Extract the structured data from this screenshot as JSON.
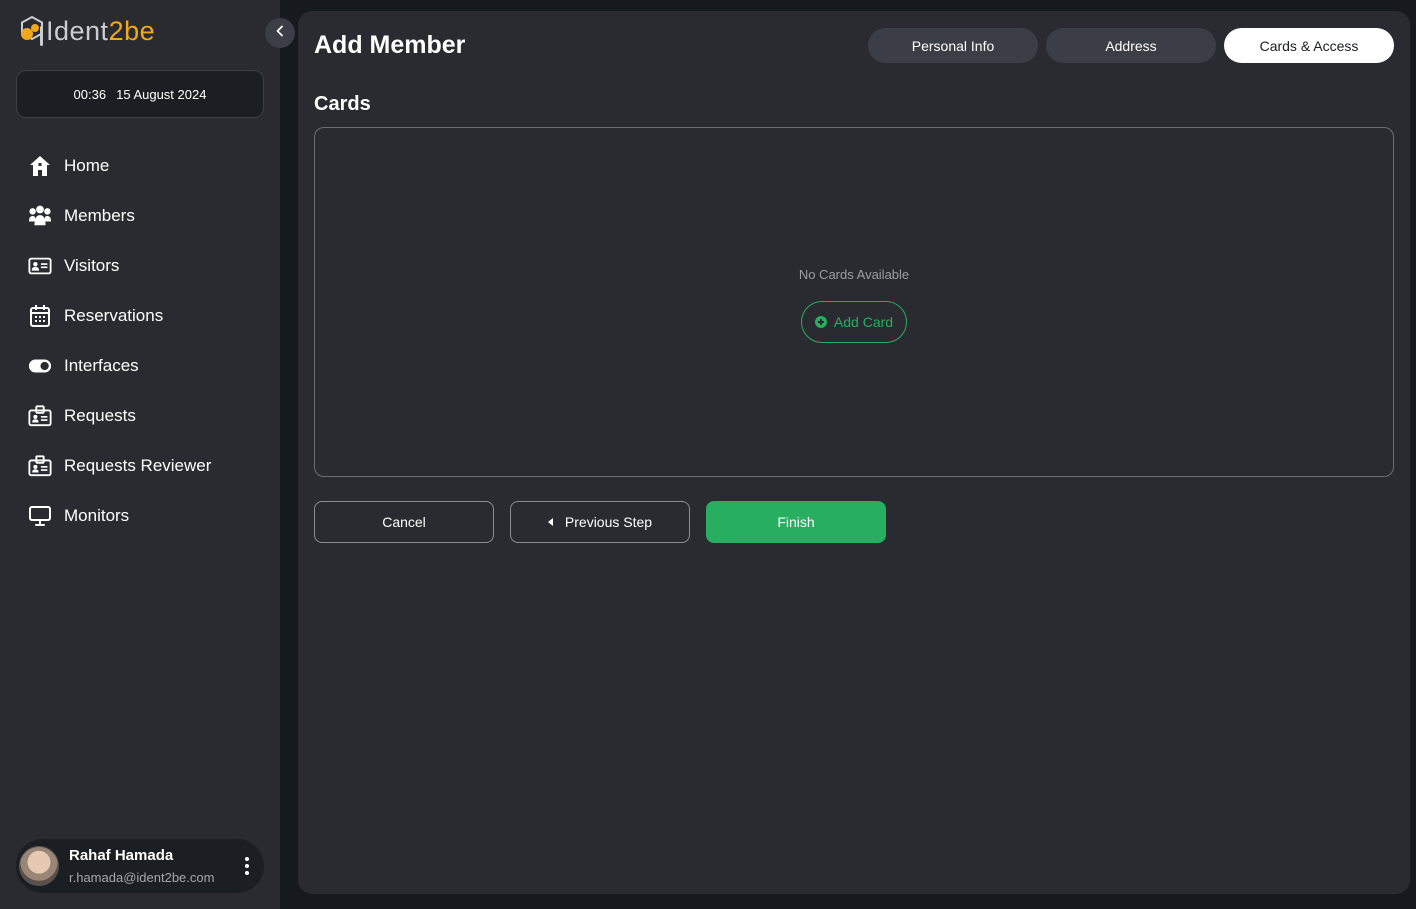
{
  "brand": {
    "name_part1": "Ident",
    "name_part2": "2be"
  },
  "clock": {
    "time": "00:36",
    "date": "15 August 2024"
  },
  "sidebar": {
    "items": [
      {
        "label": "Home",
        "icon": "home-icon"
      },
      {
        "label": "Members",
        "icon": "members-icon"
      },
      {
        "label": "Visitors",
        "icon": "visitor-card-icon"
      },
      {
        "label": "Reservations",
        "icon": "calendar-icon"
      },
      {
        "label": "Interfaces",
        "icon": "toggle-icon"
      },
      {
        "label": "Requests",
        "icon": "badge-icon"
      },
      {
        "label": "Requests Reviewer",
        "icon": "badge-icon"
      },
      {
        "label": "Monitors",
        "icon": "monitor-icon"
      }
    ]
  },
  "user": {
    "name": "Rahaf Hamada",
    "email": "r.hamada@ident2be.com"
  },
  "header": {
    "title": "Add Member",
    "tabs": [
      {
        "label": "Personal Info",
        "active": false
      },
      {
        "label": "Address",
        "active": false
      },
      {
        "label": "Cards & Access",
        "active": true
      }
    ]
  },
  "cards": {
    "title": "Cards",
    "empty_text": "No Cards Available",
    "add_label": "Add Card"
  },
  "actions": {
    "cancel_label": "Cancel",
    "previous_label": "Previous Step",
    "finish_label": "Finish"
  },
  "colors": {
    "accent": "#27ae60",
    "brand_orange": "#f0a81c",
    "panel": "#2a2b30",
    "background": "#16191e"
  }
}
